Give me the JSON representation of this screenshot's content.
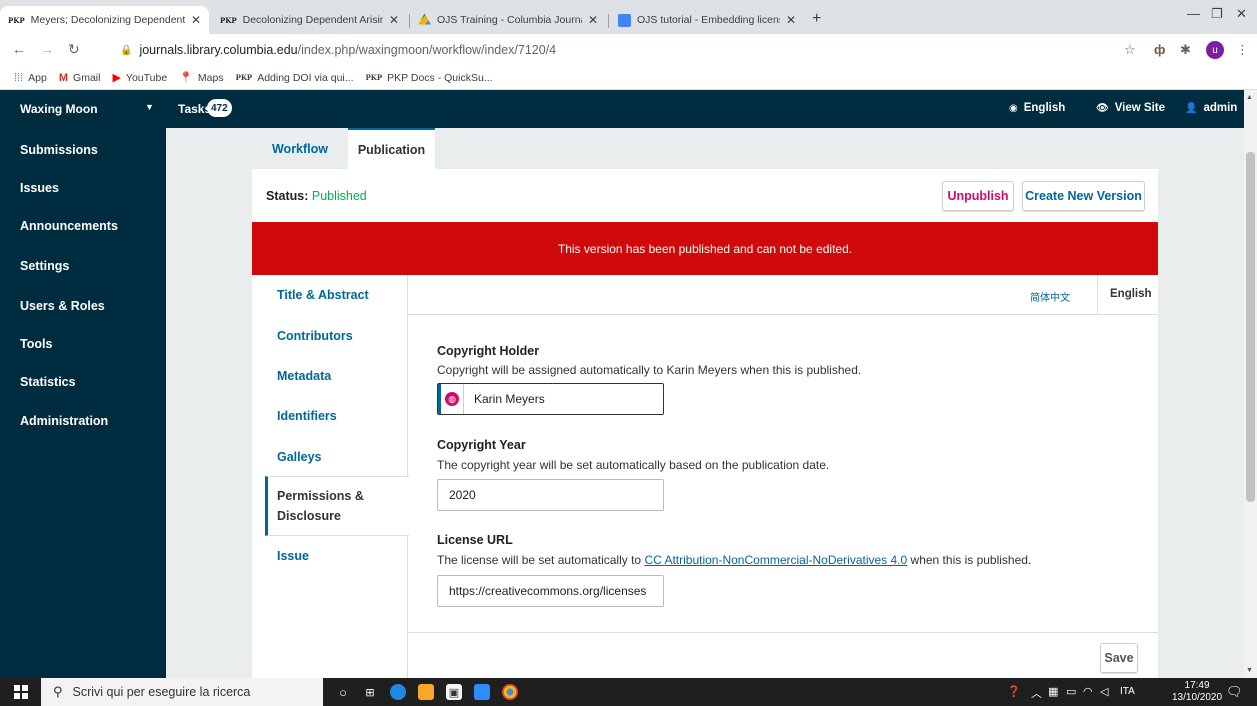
{
  "browser": {
    "tabs": [
      {
        "label": "Meyers; Decolonizing Dependent",
        "favicon": "PKP",
        "active": true
      },
      {
        "label": "Decolonizing Dependent Arising",
        "favicon": "PKP",
        "active": false
      },
      {
        "label": "OJS Training - Columbia Journals",
        "favicon": "drive-icon",
        "active": false
      },
      {
        "label": "OJS tutorial - Embedding license",
        "favicon": "docs-icon",
        "active": false
      }
    ],
    "address": {
      "host": "journals.library.columbia.edu",
      "path": "/index.php/waxingmoon/workflow/index/7120/4"
    },
    "profile_initial": "u",
    "bookmarks": [
      {
        "label": "App",
        "icon": "apps-grid-icon"
      },
      {
        "label": "Gmail",
        "icon": "gmail-icon"
      },
      {
        "label": "YouTube",
        "icon": "youtube-icon"
      },
      {
        "label": "Maps",
        "icon": "maps-icon"
      },
      {
        "label": "Adding DOI via qui...",
        "icon": "PKP"
      },
      {
        "label": "PKP Docs - QuickSu...",
        "icon": "PKP"
      }
    ]
  },
  "header": {
    "context": "Waxing Moon",
    "tasks_label": "Tasks",
    "tasks_count": "472",
    "language": "English",
    "view_site": "View Site",
    "user": "admin"
  },
  "sidebar": {
    "items": [
      "Submissions",
      "Issues",
      "Announcements",
      "Settings",
      "Users & Roles",
      "Tools",
      "Statistics",
      "Administration"
    ]
  },
  "main": {
    "tabs": {
      "workflow": "Workflow",
      "publication": "Publication"
    },
    "status_label": "Status:",
    "status_value": "Published",
    "unpublish": "Unpublish",
    "new_version": "Create New Version",
    "notice": "This version has been published and can not be edited.",
    "subnav": [
      "Title & Abstract",
      "Contributors",
      "Metadata",
      "Identifiers",
      "Galleys",
      "Permissions & Disclosure",
      "Issue"
    ],
    "languages": {
      "zh": "简体中文",
      "en": "English"
    },
    "copyright_holder": {
      "label": "Copyright Holder",
      "desc": "Copyright will be assigned automatically to Karin Meyers when this is published.",
      "value": "Karin Meyers"
    },
    "copyright_year": {
      "label": "Copyright Year",
      "desc": "The copyright year will be set automatically based on the publication date.",
      "value": "2020"
    },
    "license_url": {
      "label": "License URL",
      "desc_pre": "The license will be set automatically to ",
      "desc_link": "CC Attribution-NonCommercial-NoDerivatives 4.0",
      "desc_post": " when this is published.",
      "value": "https://creativecommons.org/licenses"
    },
    "save": "Save"
  },
  "taskbar": {
    "search_placeholder": "Scrivi qui per eseguire la ricerca",
    "lang": "ITA",
    "time": "17:49",
    "date": "13/10/2020"
  },
  "colors": {
    "primary": "#006798",
    "header": "#002c40",
    "danger": "#d00a0a",
    "accent": "#d00a6c",
    "success": "#00b24e"
  }
}
